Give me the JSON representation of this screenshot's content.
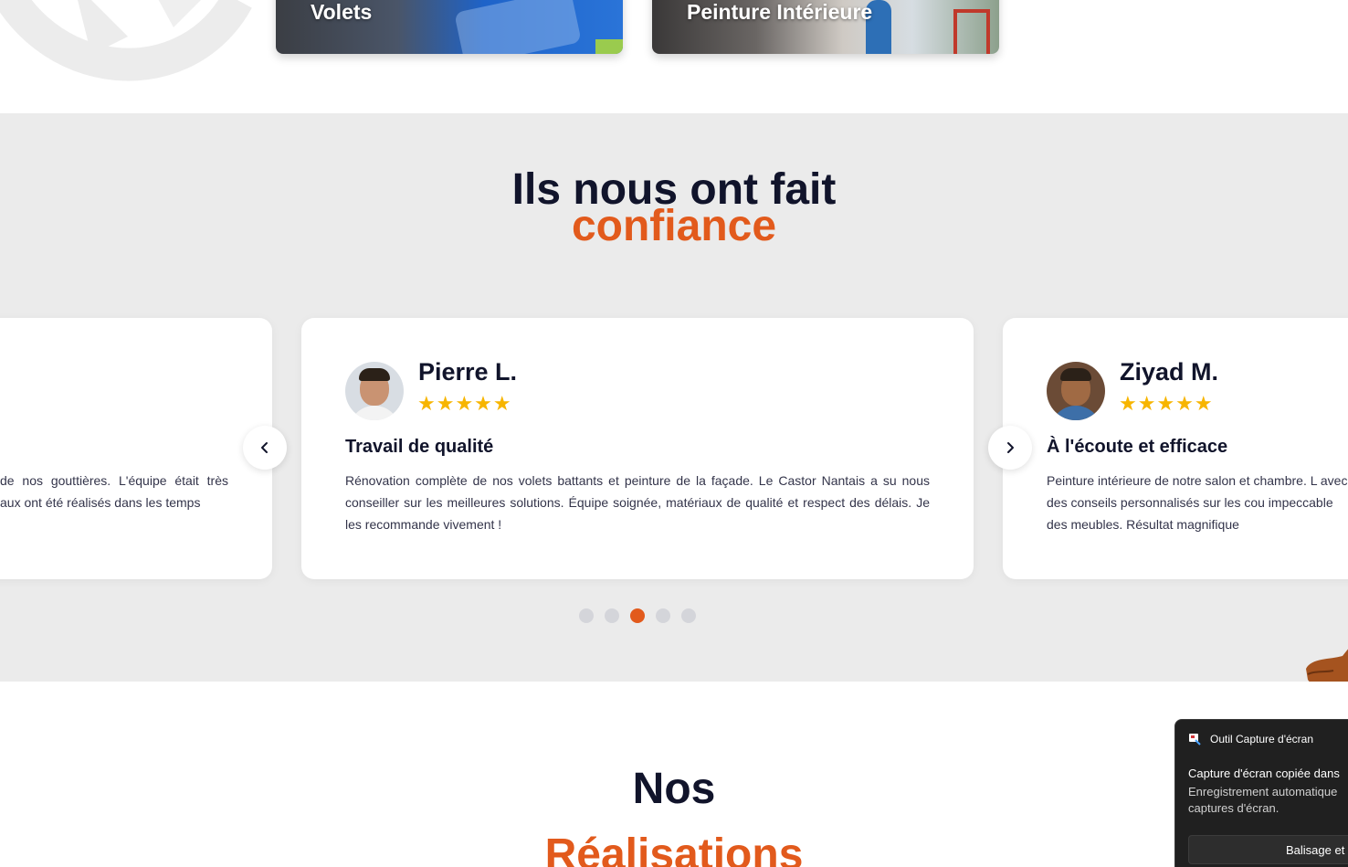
{
  "services": [
    {
      "label": "Volets"
    },
    {
      "label": "Peinture Intérieure"
    }
  ],
  "testimonials_section": {
    "title_dark": "Ils nous ont fait",
    "title_orange": "confiance",
    "cards": [
      {
        "name": "",
        "stars": "",
        "title": "",
        "body": "de nos gouttières. L'équipe était très aux ont été réalisés dans les temps"
      },
      {
        "name": "Pierre L.",
        "stars": "★★★★★",
        "rating": 5,
        "title": "Travail de qualité",
        "body": "Rénovation complète de nos volets battants et peinture de la façade. Le Castor Nantais a su nous conseiller sur les meilleures solutions. Équipe soignée, matériaux de qualité et respect des délais. Je les recommande vivement !"
      },
      {
        "name": "Ziyad M.",
        "stars": "★★★★★",
        "rating": 5,
        "title": "À l'écoute et efficace",
        "body": "Peinture intérieure de notre salon et chambre. L avec des conseils personnalisés sur les cou impeccable des meubles. Résultat magnifique"
      }
    ],
    "prev_icon": "chevron-left-icon",
    "next_icon": "chevron-right-icon",
    "dots_count": 5,
    "active_dot": 3,
    "accent_color": "#e25a1c",
    "star_color": "#f7b500"
  },
  "realisations_section": {
    "title_dark": "Nos",
    "title_orange": "Réalisations"
  },
  "notification": {
    "app_name": "Outil Capture d'écran",
    "heading": "Capture d'écran copiée dans",
    "line1": "Enregistrement automatique",
    "line2": "captures d'écran.",
    "button": "Balisage et"
  }
}
